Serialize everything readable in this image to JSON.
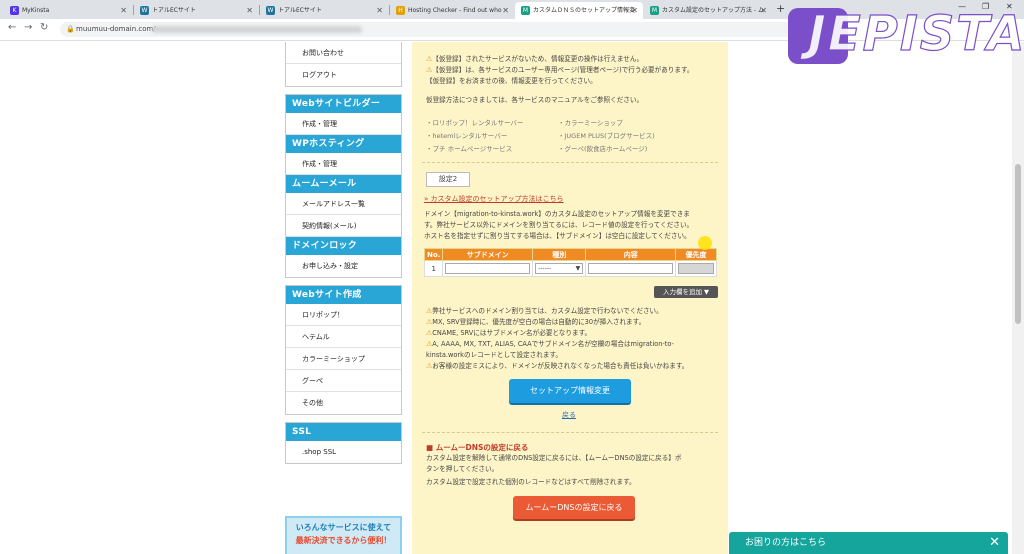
{
  "browser": {
    "tabs": [
      {
        "title": "MyKinsta",
        "icon": "K",
        "color": "#5333ed"
      },
      {
        "title": "トアルECサイト",
        "icon": "W",
        "color": "#21759b"
      },
      {
        "title": "トアルECサイト",
        "icon": "W",
        "color": "#21759b"
      },
      {
        "title": "Hosting Checker - Find out who",
        "icon": "H",
        "color": "#e2a100"
      },
      {
        "title": "カスタムＤＮＳのセットアップ情報変",
        "icon": "M",
        "color": "#16a085",
        "active": true
      },
      {
        "title": "カスタム設定のセットアップ方法 - ム",
        "icon": "M",
        "color": "#16a085"
      }
    ],
    "url": "muumuu-domain.com/",
    "newtab": "+",
    "back": "←",
    "forward": "→",
    "reload": "↻"
  },
  "sidebar": {
    "top_items": [
      "お問い合わせ",
      "ログアウト"
    ],
    "groups": [
      {
        "title": "Webサイトビルダー",
        "items": [
          "作成・管理"
        ]
      },
      {
        "title": "WPホスティング",
        "items": [
          "作成・管理"
        ]
      },
      {
        "title": "ムームーメール",
        "items": [
          "メールアドレス一覧",
          "契約情報(メール)"
        ]
      },
      {
        "title": "ドメインロック",
        "items": [
          "お申し込み・設定"
        ]
      }
    ],
    "site_group": {
      "title": "Webサイト作成",
      "items": [
        "ロリポップ！",
        "ヘテムル",
        "カラーミーショップ",
        "グーペ",
        "その他"
      ]
    },
    "ssl_group": {
      "title": "SSL",
      "items": [
        ".shop SSL"
      ]
    },
    "banner": {
      "line1": "いろんなサービスに使えて",
      "line2": "最新決済できるから便利！"
    }
  },
  "main": {
    "notes": [
      "【仮登録】されたサービスがないため、情報変更の操作は行えません。",
      "【仮登録】は、各サービスのユーザー専用ページ(管理者ページ)で行う必要があります。",
      "【仮登録】をお済ませの後、情報変更を行ってください。"
    ],
    "manual_note": "仮登録方法につきましては、各サービスのマニュアルをご参照ください。",
    "services_left": [
      "・ロリポップ！レンタルサーバー",
      "・hetemlレンタルサーバー",
      "・プチ ホームページサービス"
    ],
    "services_right": [
      "・カラーミーショップ",
      "・JUGEM PLUS(ブログサービス)",
      "・グーペ(飲食店ホームページ)"
    ],
    "setting_label": "設定2",
    "custom_link": "» カスタム設定のセットアップ方法はこちら",
    "desc": [
      "ドメイン【migration-to-kinsta.work】のカスタム設定のセットアップ情報を変更できま",
      "す。弊社サービス以外にドメインを割り当てるには、レコード値の設定を行ってください。",
      "ホスト名を指定せずに割り当てする場合は、【サブドメイン】は空白に設定してください。"
    ],
    "table": {
      "headers": [
        "No.",
        "サブドメイン",
        "種別",
        "内容",
        "優先度"
      ],
      "row": {
        "no": "1",
        "type_selected": "------"
      }
    },
    "add_field_label": "入力欄を追加 ▼",
    "warnings": [
      "弊社サービスへのドメイン割り当ては、カスタム設定で行わないでください。",
      "MX, SRV登録時に、優先度が空白の場合は自動的に30が挿入されます。",
      "CNAME, SRVにはサブドメイン名が必要となります。",
      "A, AAAA, MX, TXT, ALIAS, CAAでサブドメイン名が空欄の場合はmigration-to-",
      "kinsta.workのレコードとして設定されます。",
      "お客様の設定ミスにより、ドメインが反映されなくなった場合も責任は負いかねます。"
    ],
    "submit_label": "セットアップ情報変更",
    "back_label": "戻る",
    "reset_title": "■ ムームーDNSの設定に戻る",
    "reset_desc": [
      "カスタム設定を解除して通常のDNS設定に戻るには、【ムームーDNSの設定に戻る】ボ",
      "タンを押してください。",
      "カスタム設定で設定された個別のレコードなどはすべて削除されます。"
    ],
    "reset_button": "ムームーDNSの設定に戻る"
  },
  "help_bar": {
    "label": "お困りの方はこちら",
    "close": "✕"
  },
  "watermark": "JEPISTA"
}
